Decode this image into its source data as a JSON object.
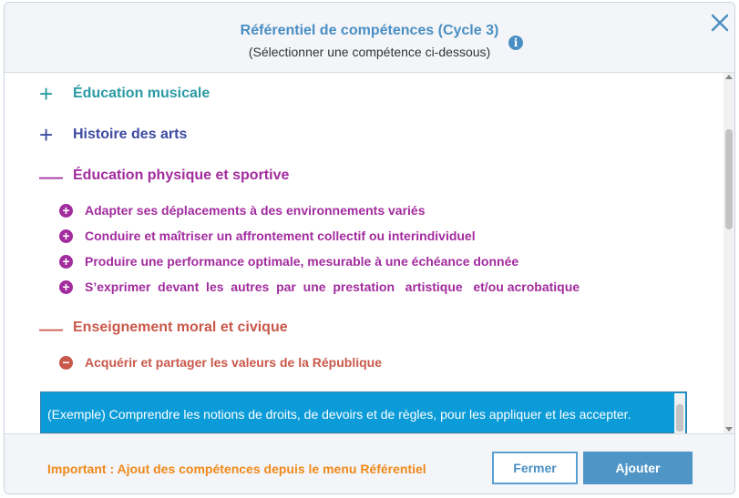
{
  "header": {
    "title": "Référentiel de compétences (Cycle 3)",
    "subtitle": "(Sélectionner une compétence ci-dessous)"
  },
  "colors": {
    "accent": "#4a8fc4",
    "musique": "#2a9aa4",
    "arts": "#3e4ba0",
    "eps": "#a22c9e",
    "emc": "#c9584a",
    "selection": "#0a9bd8",
    "notice": "#ef8a1a"
  },
  "domains": [
    {
      "symbol": "+",
      "label": "Éducation musicale",
      "icon": "plus-icon"
    },
    {
      "symbol": "+",
      "label": "Histoire des arts",
      "icon": "plus-icon"
    },
    {
      "symbol": "—",
      "label": "Éducation physique et sportive",
      "icon": "minus-icon"
    },
    {
      "symbol": "—",
      "label": "Enseignement moral et civique",
      "icon": "minus-icon"
    }
  ],
  "eps_skills": [
    {
      "symbol": "+",
      "label": "Adapter ses déplacements à des environnements variés"
    },
    {
      "symbol": "+",
      "label": "Conduire et maîtriser un affrontement collectif ou interindividuel"
    },
    {
      "symbol": "+",
      "label": "Produire une performance optimale, mesurable à une échéance donnée"
    },
    {
      "symbol": "+",
      "label": "S’exprimer  devant  les  autres  par  une  prestation   artistique   et/ou acrobatique"
    }
  ],
  "emc_skills": [
    {
      "symbol": "−",
      "label": "Acquérir et partager les valeurs de la République"
    }
  ],
  "example_item": "(Exemple) Comprendre les notions de droits, de devoirs et de règles, pour les appliquer et les accepter.",
  "footer": {
    "notice": "Important : Ajout des compétences depuis le menu Référentiel",
    "close_label": "Fermer",
    "add_label": "Ajouter"
  }
}
